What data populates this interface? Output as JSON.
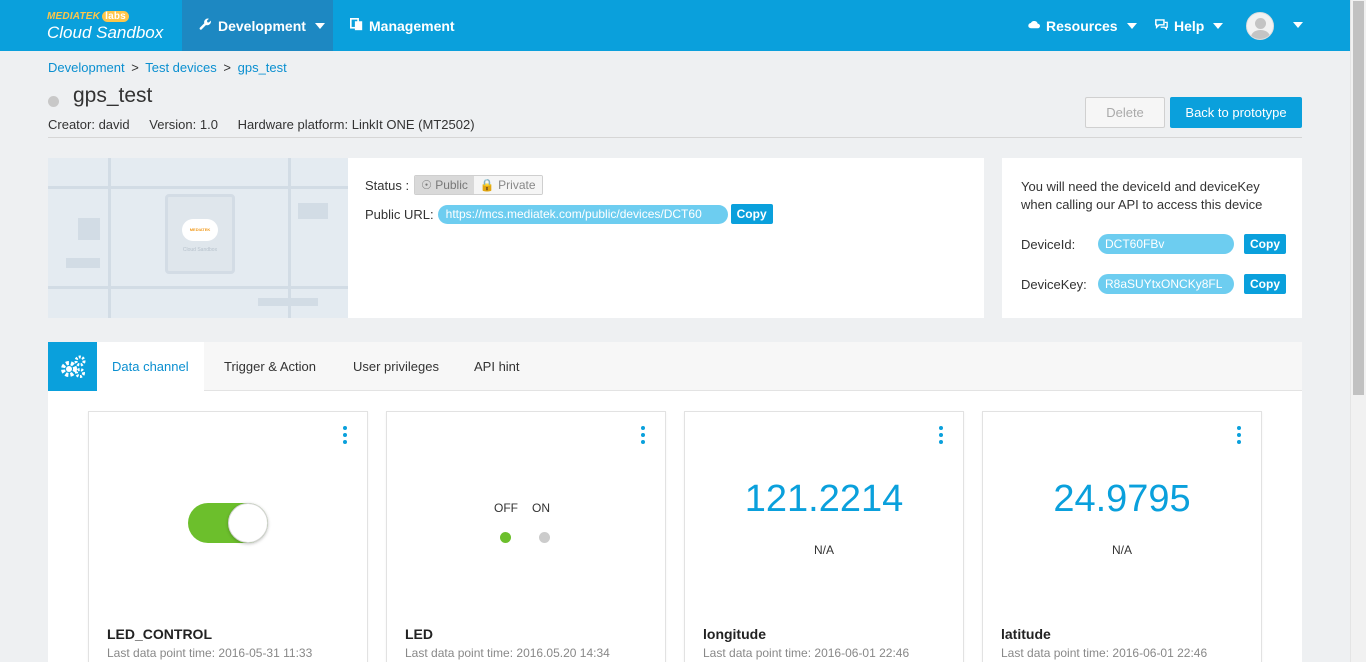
{
  "brand": {
    "top": "MEDIATEK",
    "labs": "labs",
    "bottom": "Cloud Sandbox"
  },
  "nav": {
    "development": "Development",
    "management": "Management",
    "resources": "Resources",
    "help": "Help"
  },
  "breadcrumb": {
    "items": [
      "Development",
      "Test devices",
      "gps_test"
    ],
    "separator": ">"
  },
  "device": {
    "title": "gps_test",
    "creator": "Creator: david",
    "version": "Version: 1.0",
    "platform": "Hardware platform: LinkIt ONE (MT2502)"
  },
  "actions": {
    "delete": "Delete",
    "back": "Back to prototype"
  },
  "board_image": {
    "logo": "MEDIATEK",
    "sub": "Cloud Sandbox"
  },
  "status": {
    "label": "Status :",
    "public": "Public",
    "private": "Private",
    "selected": "Public",
    "url_label": "Public URL:",
    "url": "https://mcs.mediatek.com/public/devices/DCT60",
    "copy": "Copy"
  },
  "keys": {
    "note": "You will need the deviceId and deviceKey when calling our API to access this device",
    "device_id_label": "DeviceId:",
    "device_id": "DCT60FBv",
    "device_key_label": "DeviceKey:",
    "device_key": "R8aSUYtxONCKy8FL",
    "copy": "Copy"
  },
  "tabs": [
    "Data channel",
    "Trigger & Action",
    "User privileges",
    "API hint"
  ],
  "active_tab": "Data channel",
  "cards": [
    {
      "name": "LED_CONTROL",
      "time": "Last data point time: 2016-05-31 11:33",
      "type": "switch",
      "state": "on"
    },
    {
      "name": "LED",
      "time": "Last data point time: 2016.05.20 14:34",
      "type": "led",
      "off_label": "OFF",
      "on_label": "ON",
      "state": "off"
    },
    {
      "name": "longitude",
      "time": "Last data point time: 2016-06-01 22:46",
      "type": "value",
      "value": "121.2214",
      "unit": "N/A"
    },
    {
      "name": "latitude",
      "time": "Last data point time: 2016-06-01 22:46",
      "type": "value",
      "value": "24.9795",
      "unit": "N/A"
    }
  ],
  "colors": {
    "primary": "#0aa0dc",
    "switch_on": "#6cbf2c",
    "led_on": "#6cbf2c",
    "led_off": "#cccccc"
  },
  "icons": [
    "wrench-icon",
    "documents-icon",
    "cloud-icon",
    "chat-icon",
    "avatar",
    "gears-icon",
    "globe-icon",
    "lock-icon",
    "kebab-icon"
  ]
}
